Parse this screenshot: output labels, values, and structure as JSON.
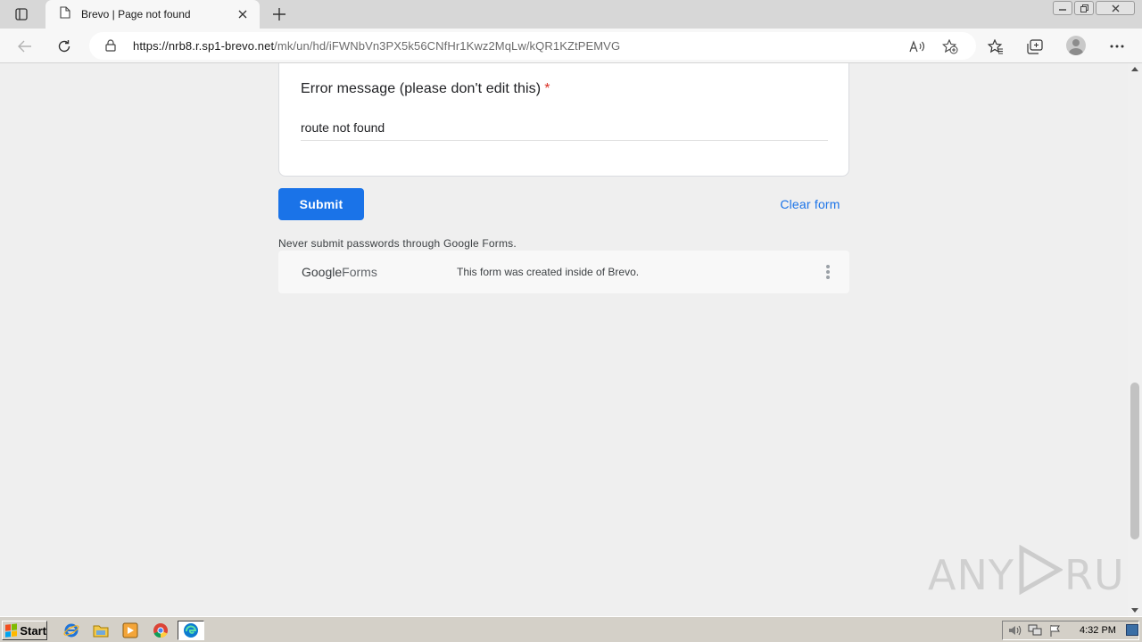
{
  "browser": {
    "tab_title": "Brevo | Page not found",
    "url_host": "https://nrb8.r.sp1-brevo.net",
    "url_path": "/mk/un/hd/iFWNbVn3PX5k56CNfHr1Kwz2MqLw/kQR1KZtPEMVG"
  },
  "form": {
    "question_label": "Error message (please don't edit this)",
    "required_mark": "*",
    "answer_value": "route not found",
    "submit_label": "Submit",
    "clear_label": "Clear form",
    "password_warning": "Never submit passwords through Google Forms.",
    "footer_brand_google": "Google",
    "footer_brand_forms": "Forms",
    "footer_note": "This form was created inside of Brevo."
  },
  "watermark": {
    "left": "ANY",
    "right": "RUN"
  },
  "taskbar": {
    "start_label": "Start",
    "clock": "4:32 PM"
  },
  "colors": {
    "accent": "#1a73e8",
    "required": "#d93025",
    "page_bg": "#efefef",
    "card_bg": "#ffffff"
  },
  "icons": {
    "tab_actions": "tab-actions-icon",
    "page": "page-icon",
    "close": "close-icon",
    "new_tab": "plus-icon",
    "back": "back-arrow-icon",
    "refresh": "refresh-icon",
    "lock": "lock-icon",
    "read_aloud": "read-aloud-icon",
    "add_favorite": "add-favorite-icon",
    "favorites": "favorites-icon",
    "collections": "collections-icon",
    "profile": "profile-avatar",
    "more": "more-icon"
  }
}
